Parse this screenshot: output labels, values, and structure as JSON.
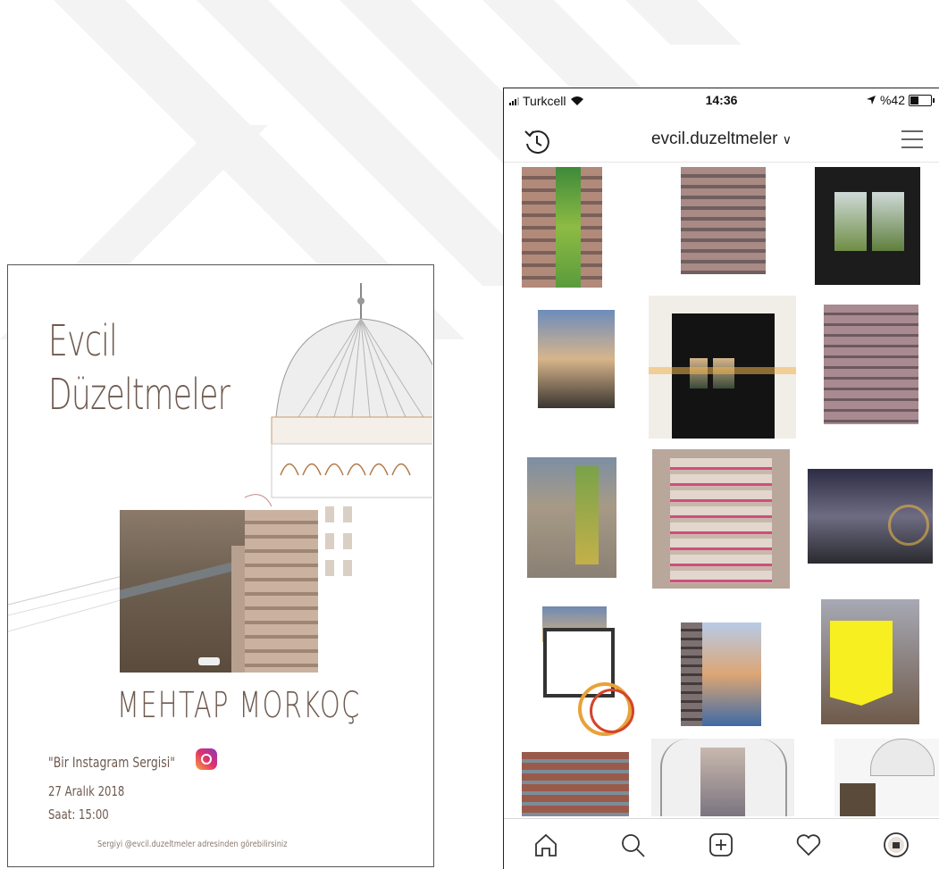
{
  "poster": {
    "title_line1": "Evcil",
    "title_line2": "Düzeltmeler",
    "artist": "MEHTAP MORKOÇ",
    "subtitle": "\"Bir Instagram Sergisi\"",
    "date": "27 Aralık 2018",
    "time": "Saat: 15:00",
    "footnote": "Sergiyi @evcil.duzeltmeler adresinden görebilirsiniz"
  },
  "phone": {
    "status": {
      "carrier": "Turkcell",
      "time": "14:36",
      "battery": "%42",
      "battery_level": 0.42
    },
    "header": {
      "username": "evcil.duzeltmeler",
      "chevron": "∨"
    },
    "grid_icons": [
      "history-icon",
      "menu-icon"
    ],
    "tabs": [
      {
        "name": "home-icon"
      },
      {
        "name": "search-icon"
      },
      {
        "name": "add-post-icon"
      },
      {
        "name": "heart-icon"
      },
      {
        "name": "profile-icon"
      }
    ]
  }
}
